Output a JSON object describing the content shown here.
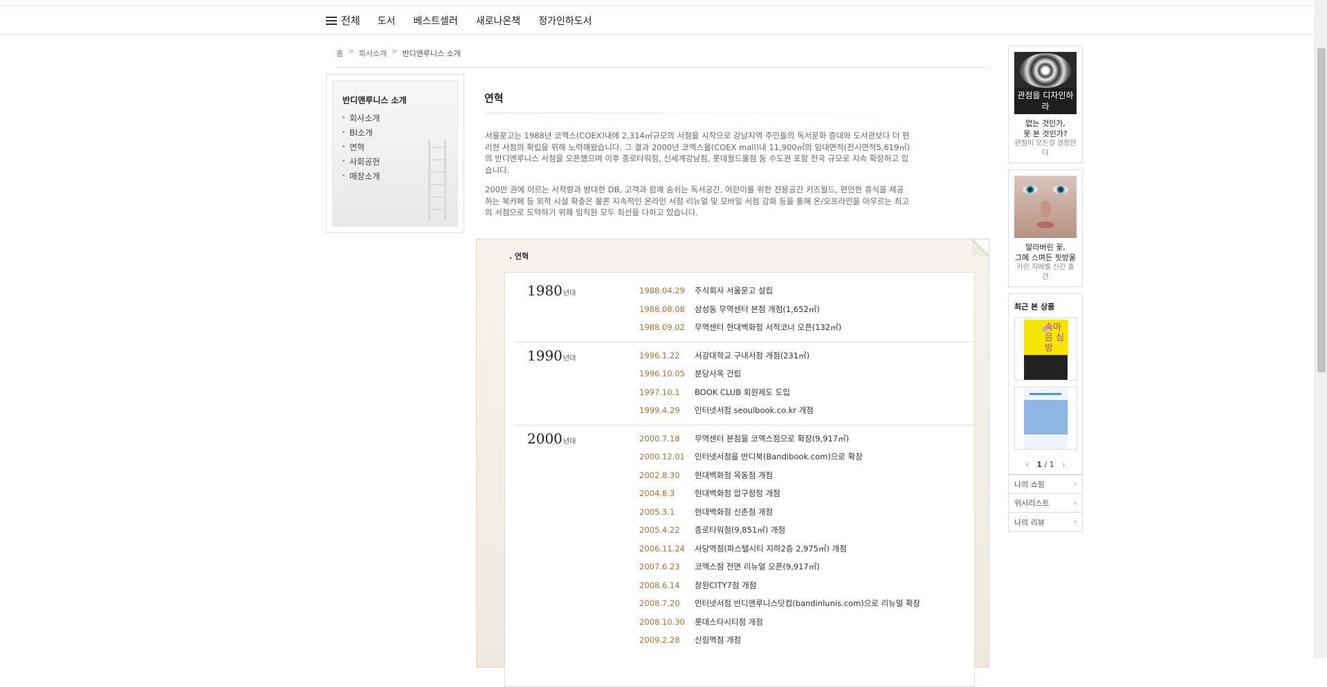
{
  "nav": {
    "all_label": "전체",
    "items": [
      "도서",
      "베스트셀러",
      "새로나온책",
      "정가인하도서"
    ]
  },
  "breadcrumb": {
    "home": "홈",
    "level1": "회사소개",
    "current": "반디앤루니스 소개"
  },
  "sidebar": {
    "title": "반디앤루니스 소개",
    "items": [
      "회사소개",
      "BI소개",
      "연혁",
      "사회공헌",
      "매장소개"
    ]
  },
  "section": {
    "title": "연혁",
    "intro_1": "서울문고는 1988년 코엑스(COEX)내에 2,314㎡규모의 서점을 시작으로 강남지역 주민들의 독서문화 증대와 도서관보다 더 편리한 서점의 확립을 위해 노력해왔습니다. 그 결과 2000년 코엑스몰(COEX mall)내 11,900㎡의 임대면적(전시면적5,619㎡)의 반디앤루니스 서점을 오픈했으며 이후 종로타워점, 신세계강남점, 롯데월드몰점 등 수도권 포함 전국 규모로 지속 확장하고 있습니다.",
    "intro_2": "200만 권에 이르는 서적량과 방대한 DB, 고객과 함께 숨쉬는 독서공간, 어린이를 위한 전용공간 키즈월드, 편안한 휴식을 제공하는 북카페 등 외적 시설 확충은 물론 지속적인 온라인 서점 리뉴얼 및 모바일 서점 강화 등을 통해 온/오프라인을 아우르는 최고의 서점으로 도약하기 위해 임직원 모두 최선을 다하고 있습니다."
  },
  "history": {
    "label": ". 연혁",
    "decade_suffix": "년대",
    "decades": [
      {
        "year": "1980",
        "events": [
          {
            "date": "1988.04.29",
            "text": "주식회사 서울문고 설립"
          },
          {
            "date": "1988.08.08",
            "text": "삼성동 무역센터 본점 개점(1,652㎡)"
          },
          {
            "date": "1988.09.02",
            "text": "무역센터 현대백화점 서적코너 오픈(132㎡)"
          }
        ]
      },
      {
        "year": "1990",
        "events": [
          {
            "date": "1996.1.22",
            "text": "서강대학교 구내서점 개점(231㎡)"
          },
          {
            "date": "1996.10.05",
            "text": "분당사옥 건립"
          },
          {
            "date": "1997.10.1",
            "text": "BOOK CLUB 회원제도 도입"
          },
          {
            "date": "1999.4.29",
            "text": "인터넷서점 seoulbook.co.kr 개점"
          }
        ]
      },
      {
        "year": "2000",
        "events": [
          {
            "date": "2000.7.18",
            "text": "무역센터 본점을 코엑스점으로 확장(9,917㎡)"
          },
          {
            "date": "2000.12.01",
            "text": "인터넷서점을 반디북(Bandibook.com)으로 확장"
          },
          {
            "date": "2002.8.30",
            "text": "현대백화점 목동점 개점"
          },
          {
            "date": "2004.8.3",
            "text": "현대백화점 압구정점 개점"
          },
          {
            "date": "2005.3.1",
            "text": "현대백화점 신촌점 개점"
          },
          {
            "date": "2005.4.22",
            "text": "종로타워점(9,851㎡) 개점"
          },
          {
            "date": "2006.11.24",
            "text": "사당역점(파스텔시티 지하2층 2,975㎡) 개점"
          },
          {
            "date": "2007.6.23",
            "text": "코엑스점 전면 리뉴얼 오픈(9,917㎡)"
          },
          {
            "date": "2008.6.14",
            "text": "창원CITY7점 개점"
          },
          {
            "date": "2008.7.20",
            "text": "인터넷서점 반디앤루니스닷컴(bandinlunis.com)으로 리뉴얼 확장"
          },
          {
            "date": "2008.10.30",
            "text": "롯데스타시티점 개점"
          },
          {
            "date": "2009.2.28",
            "text": "신림역점 개점"
          }
        ]
      }
    ]
  },
  "right_ads": [
    {
      "cover_text": "관점을 디자인하라",
      "line1": "없는 것인가,",
      "line1b": "못 본 것인가?",
      "line2": "관점이 모든걸 결정한다"
    },
    {
      "line1": "말라버린 꽃,",
      "line1b": "그에 스며든 핏방울",
      "line2": "카린 지에벨 신간 출간"
    }
  ],
  "recent": {
    "title": "최근 본 상품",
    "book1_cover_text": "속마음 심방",
    "pager": "1 / 1",
    "pager_current": "1",
    "pager_total": "1"
  },
  "my_links": [
    "나의 쇼핑",
    "위시리스트",
    "나의 리뷰"
  ],
  "colors": {
    "date": "#a87433",
    "accent_border": "#ddd5c7"
  }
}
